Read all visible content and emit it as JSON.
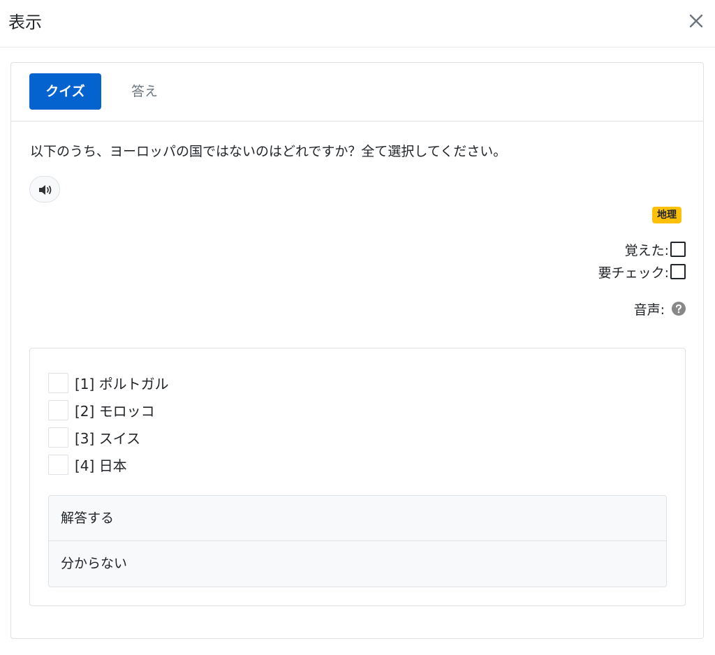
{
  "modal": {
    "title": "表示"
  },
  "tabs": [
    {
      "label": "クイズ",
      "active": true
    },
    {
      "label": "答え",
      "active": false
    }
  ],
  "question": {
    "text": "以下のうち、ヨーロッパの国ではないのはどれですか？全て選択してください。"
  },
  "tag": {
    "label": "地理",
    "color": "#ffc107"
  },
  "flags": {
    "memorized_label": "覚えた:",
    "memorized_checked": false,
    "review_label": "要チェック:",
    "review_checked": false,
    "audio_label": "音声:"
  },
  "choices": [
    {
      "label": "[1] ポルトガル",
      "checked": false
    },
    {
      "label": "[2] モロッコ",
      "checked": false
    },
    {
      "label": "[3] スイス",
      "checked": false
    },
    {
      "label": "[4] 日本",
      "checked": false
    }
  ],
  "actions": {
    "submit_label": "解答する",
    "unknown_label": "分からない"
  },
  "colors": {
    "primary": "#0563d0",
    "badge": "#ffc107",
    "border": "#dee2e6"
  },
  "icons": {
    "close": "close-icon",
    "speaker": "speaker-icon",
    "help": "question-circle-icon"
  }
}
